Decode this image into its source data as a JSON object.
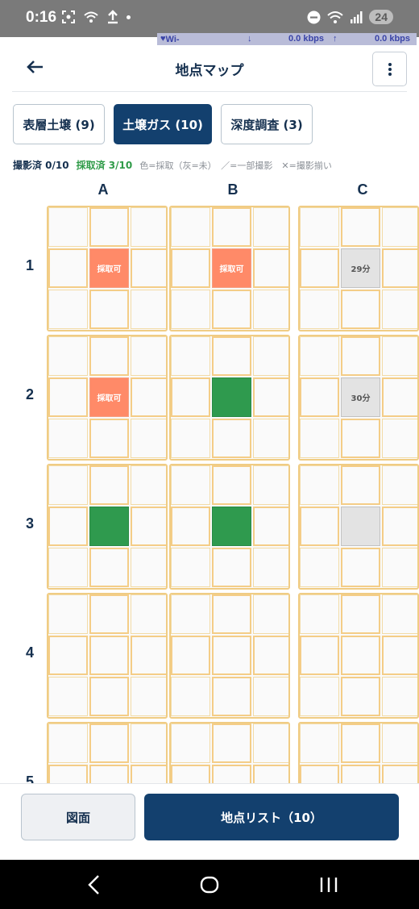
{
  "status_bar": {
    "time": "0:16",
    "battery": "24",
    "network_label": "Wi-Fi",
    "download_speed": "0.0 kbps",
    "upload_speed": "0.0 kbps"
  },
  "header": {
    "title": "地点マップ",
    "back_icon": "arrow-left-icon",
    "menu_icon": "more-vertical-icon"
  },
  "tabs": [
    {
      "label": "表層土壌 (9)",
      "active": false
    },
    {
      "label": "土壌ガス (10)",
      "active": true
    },
    {
      "label": "深度調査 (3)",
      "active": false
    }
  ],
  "summary": {
    "shot": "撮影済 0/10",
    "taken": "採取済 3/10",
    "legend": "色=採取（灰=未）　／=一部撮影　✕=撮影揃い"
  },
  "grid": {
    "columns": [
      "A",
      "B",
      "C"
    ],
    "rows": [
      "1",
      "2",
      "3",
      "4",
      "5"
    ],
    "cells": {
      "1": {
        "A": {
          "state": "taken",
          "label": "採取可"
        },
        "B": {
          "state": "taken",
          "label": "採取可"
        },
        "C": {
          "state": "gray",
          "label": "29分"
        }
      },
      "2": {
        "A": {
          "state": "taken",
          "label": "採取可"
        },
        "B": {
          "state": "done",
          "label": ""
        },
        "C": {
          "state": "gray",
          "label": "30分"
        }
      },
      "3": {
        "A": {
          "state": "done",
          "label": ""
        },
        "B": {
          "state": "done",
          "label": ""
        },
        "C": {
          "state": "gray",
          "label": ""
        }
      }
    }
  },
  "footer": {
    "drawing_label": "図面",
    "list_label": "地点リスト（10）"
  },
  "colors": {
    "primary": "#13406e",
    "taken": "#ff8a68",
    "done": "#2f9a4e",
    "pending": "#e3e3e3",
    "block_border": "#f0cc84"
  }
}
